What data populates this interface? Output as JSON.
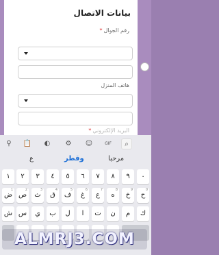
{
  "form": {
    "title": "بيانات الاتصال",
    "mobile_label": "رقم الجوال",
    "required_mark": "*",
    "home_label": "هاتف المنزل",
    "email_label": "البريد الإلكتروني"
  },
  "keyboard": {
    "toolbar": {
      "icons": [
        "pin-icon",
        "clipboard-icon",
        "palette-icon",
        "gear-icon",
        "sticker-icon",
        "gif-icon",
        "search-icon"
      ],
      "gif_label": "GIF"
    },
    "suggestions": [
      "مرحبا",
      "وقطر",
      "ع"
    ],
    "row1": [
      "١",
      "٢",
      "٣",
      "٤",
      "٥",
      "٦",
      "٧",
      "٨",
      "٩",
      "٠"
    ],
    "row2": [
      "ض",
      "ص",
      "ث",
      "ق",
      "ف",
      "غ",
      "ع",
      "ه",
      "خ",
      "ح"
    ],
    "row2_hints": [
      "1",
      "2",
      "3",
      "4",
      "5",
      "6",
      "7",
      "8",
      "9",
      "0"
    ],
    "row3": [
      "ش",
      "س",
      "ي",
      "ب",
      "ل",
      "ا",
      "ت",
      "ن",
      "م",
      "ك"
    ]
  },
  "watermark": "ALMRJ3.COM"
}
